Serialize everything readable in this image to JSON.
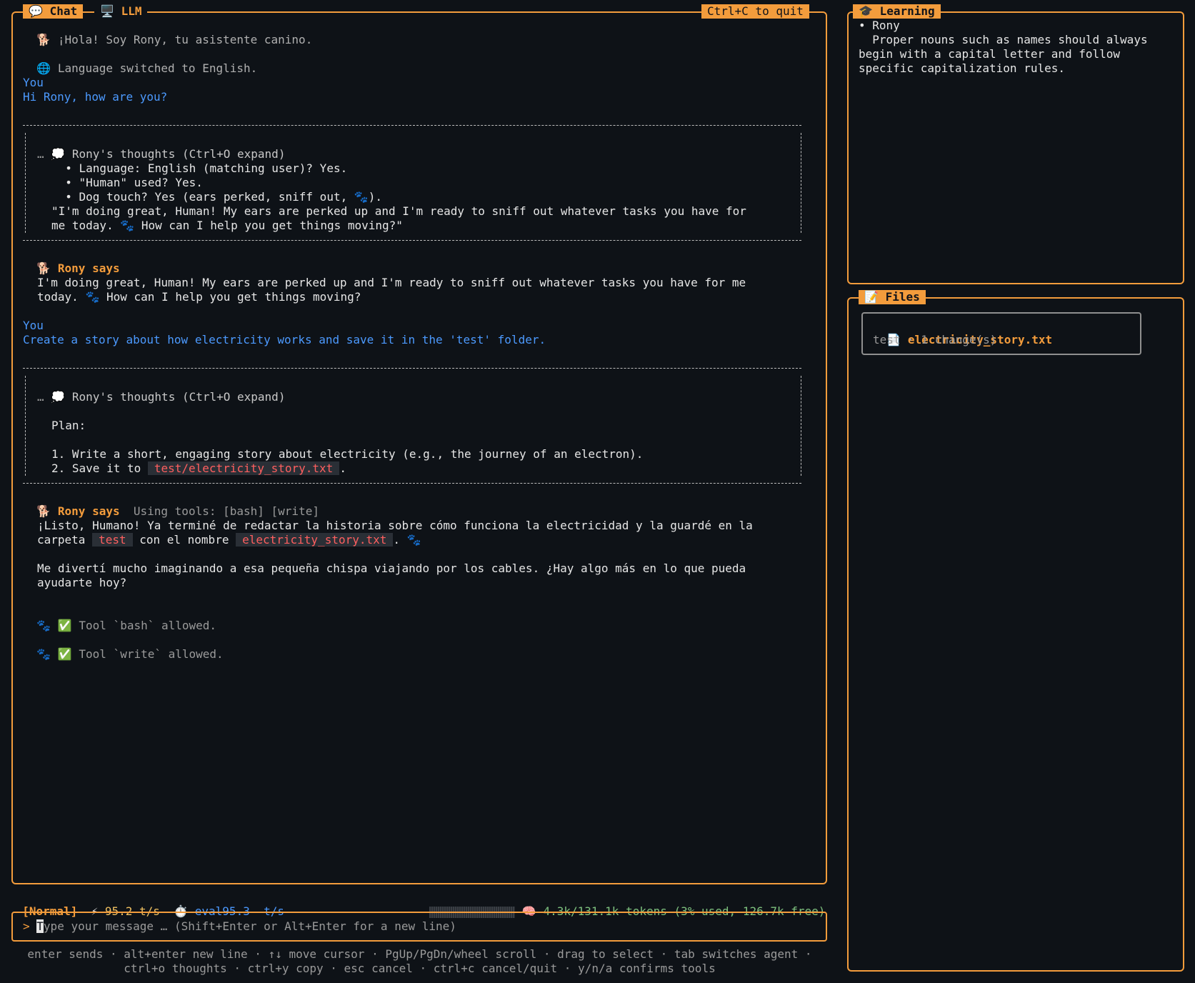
{
  "chat_panel": {
    "tab_chat_icon": "speech-bubble-icon",
    "tab_chat": "Chat",
    "tab_llm_icon": "computer-icon",
    "tab_llm": "LLM",
    "quit_hint": "Ctrl+C to quit"
  },
  "messages": {
    "greeting": "¡Hola! Soy Rony, tu asistente canino.",
    "language_switch": "Language switched to English.",
    "you_label": "You",
    "user_msg_1": "Hi Rony, how are you?",
    "thoughts_title": "Rony's thoughts (Ctrl+O expand)",
    "ellipsis": "…",
    "thought1_lines": [
      "  • Language: English (matching user)? Yes.",
      "  • \"Human\" used? Yes.",
      "  • Dog touch? Yes (ears perked, sniff out, "
    ],
    "thought1_line3_end": ").",
    "thought1_quote_1": "\"I'm doing great, Human! My ears are perked up and I'm ready to sniff out whatever tasks you have for",
    "thought1_quote_2a": "me today. ",
    "thought1_quote_2b": " How can I help you get things moving?\"",
    "rony_says": "Rony says",
    "reply1_line1": "I'm doing great, Human! My ears are perked up and I'm ready to sniff out whatever tasks you have for me",
    "reply1_line2a": "today. ",
    "reply1_line2b": " How can I help you get things moving?",
    "user_msg_2": "Create a story about how electricity works and save it in the 'test' folder.",
    "plan_label": "Plan:",
    "plan_step1": "1. Write a short, engaging story about electricity (e.g., the journey of an electron).",
    "plan_step2_prefix": "2. Save it to ",
    "plan_step2_code": "test/electricity_story.txt",
    "plan_step2_suffix": ".",
    "tools_note": "Using tools: [bash] [write]",
    "reply2_line1": "¡Listo, Humano! Ya terminé de redactar la historia sobre cómo funciona la electricidad y la guardé en la",
    "reply2_l2_a": "carpeta ",
    "reply2_l2_code1": "test",
    "reply2_l2_b": " con el nombre ",
    "reply2_l2_code2": "electricity_story.txt",
    "reply2_l2_c": ".",
    "reply2_line3": "Me divertí mucho imaginando a esa pequeña chispa viajando por los cables. ¿Hay algo más en lo que pueda",
    "reply2_line4": "ayudarte hoy?",
    "tool_bash": "Tool `bash` allowed.",
    "tool_write": "Tool `write` allowed."
  },
  "status_bar": {
    "mode": "[Normal]",
    "speed": "95.2 t/s",
    "eval": "eval95.3  t/s",
    "tokens": "4.3k/131.1k tokens (3% used, 126.7k free)",
    "context_used_fraction": 0.03
  },
  "input": {
    "prompt": ">",
    "cursor_char": "T",
    "placeholder_rest": "ype your message … (Shift+Enter or Alt+Enter for a new line)"
  },
  "help": {
    "line1": "enter sends · alt+enter new line · ↑↓ move cursor · PgUp/PgDn/wheel scroll · drag to select · tab switches agent ·",
    "line2": "ctrl+o thoughts · ctrl+y copy · esc cancel · ctrl+c cancel/quit · y/n/a confirms tools"
  },
  "learning_panel": {
    "title_icon": "graduation-cap-icon",
    "title": "Learning",
    "item_name": "• Rony",
    "item_text_1": "  Proper nouns such as names should always",
    "item_text_2": "begin with a capital letter and follow",
    "item_text_3": "specific capitalization rules."
  },
  "files_panel": {
    "title_icon": "memo-icon",
    "title": "Files",
    "file_icon": "document-icon",
    "file_name": "electricity_story.txt",
    "file_meta": "test · 1 change(s)"
  },
  "colors": {
    "accent": "#f39c3c",
    "background": "#0e1217",
    "user_text": "#4c9aff",
    "code_text": "#ff5f5f",
    "tokens_text": "#7ec27e"
  }
}
